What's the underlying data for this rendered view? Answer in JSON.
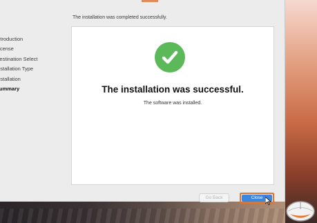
{
  "window": {
    "header_text": "The installation was completed successfully."
  },
  "sidebar": {
    "steps": [
      {
        "label": "Introduction"
      },
      {
        "label": "License"
      },
      {
        "label": "Destination Select"
      },
      {
        "label": "Installation Type"
      },
      {
        "label": "Installation"
      },
      {
        "label": "Summary",
        "active": true
      }
    ]
  },
  "main": {
    "icon": "checkmark-circle-icon",
    "title": "The installation was successful.",
    "subtitle": "The software was installed."
  },
  "footer": {
    "go_back_label": "Go Back",
    "close_label": "Close"
  },
  "colors": {
    "success_green": "#5cb95a",
    "primary_button": "#3b86e0",
    "highlight_orange": "#e8742c"
  }
}
